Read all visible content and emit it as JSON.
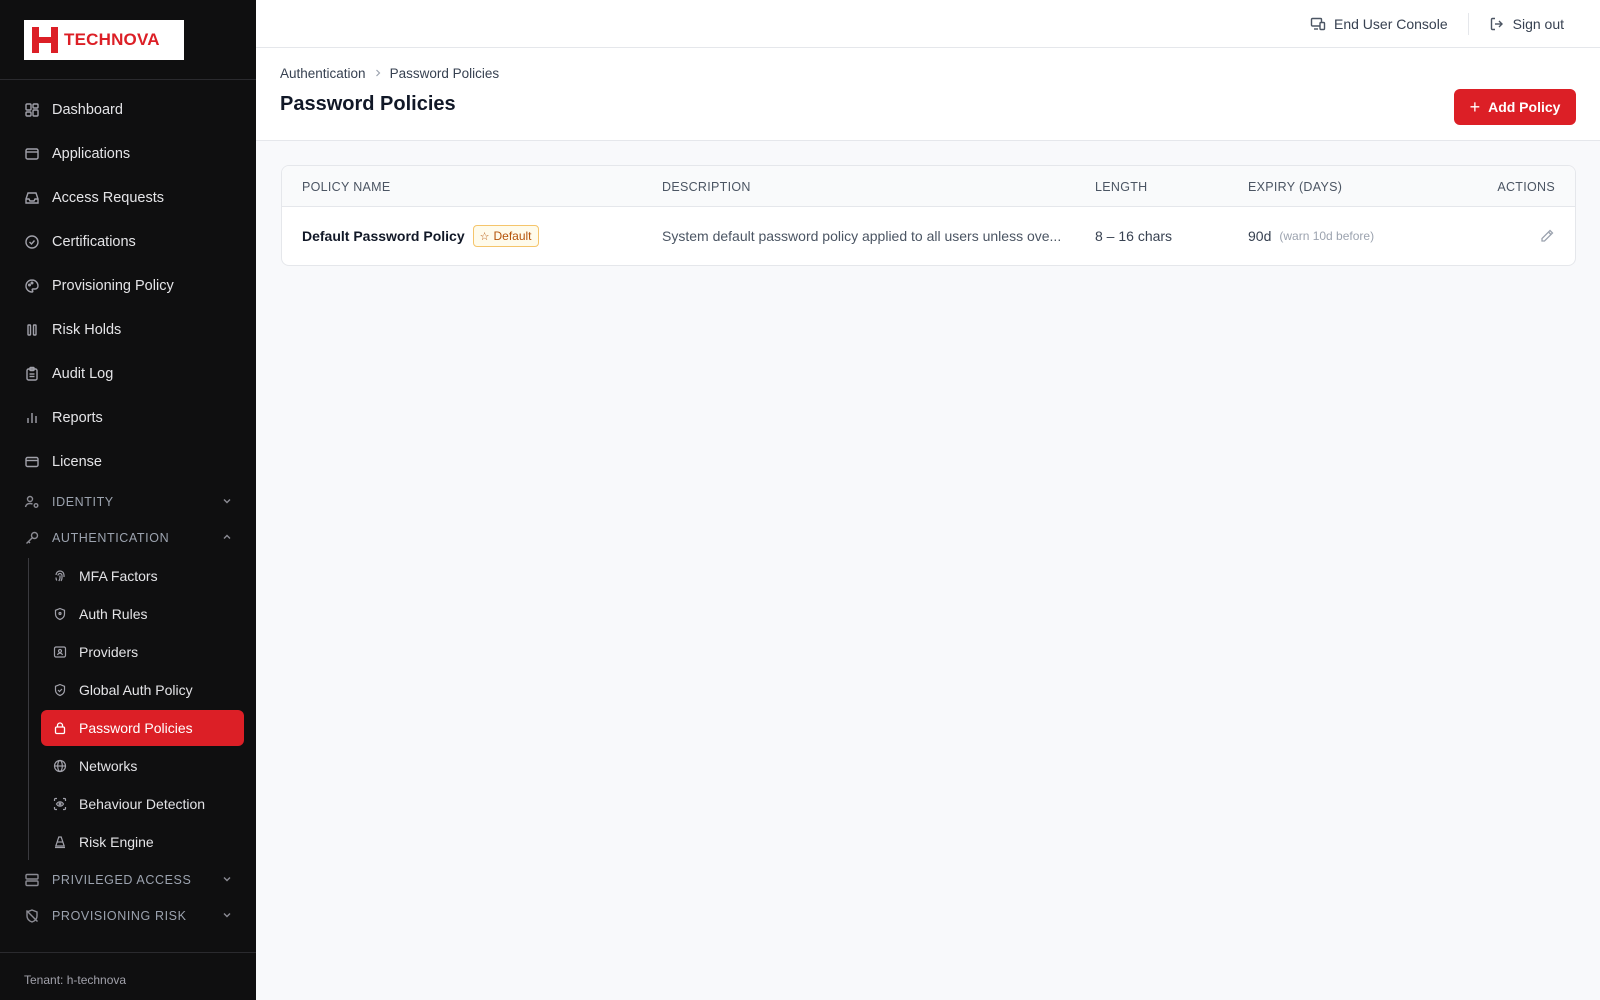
{
  "brand": {
    "name": "TECHNOVA",
    "accent": "#dc1f26"
  },
  "sidebar": {
    "items": [
      {
        "label": "Dashboard",
        "icon": "grid-icon"
      },
      {
        "label": "Applications",
        "icon": "browser-window-icon"
      },
      {
        "label": "Access Requests",
        "icon": "inbox-icon"
      },
      {
        "label": "Certifications",
        "icon": "check-circle-icon"
      },
      {
        "label": "Provisioning Policy",
        "icon": "palette-icon"
      },
      {
        "label": "Risk Holds",
        "icon": "pause-icon"
      },
      {
        "label": "Audit Log",
        "icon": "clipboard-icon"
      },
      {
        "label": "Reports",
        "icon": "bar-chart-icon"
      },
      {
        "label": "License",
        "icon": "credit-card-icon"
      }
    ],
    "sections": {
      "identity": {
        "label": "IDENTITY",
        "icon": "user-cog-icon"
      },
      "authentication": {
        "label": "AUTHENTICATION",
        "icon": "key-icon"
      },
      "privileged": {
        "label": "PRIVILEGED ACCESS",
        "icon": "server-icon"
      },
      "provisioning_risk": {
        "label": "PROVISIONING RISK",
        "icon": "shield-off-icon"
      }
    },
    "auth_items": [
      {
        "label": "MFA Factors",
        "icon": "fingerprint-icon"
      },
      {
        "label": "Auth Rules",
        "icon": "shield-icon"
      },
      {
        "label": "Providers",
        "icon": "id-card-icon"
      },
      {
        "label": "Global Auth Policy",
        "icon": "shield-check-icon"
      },
      {
        "label": "Password Policies",
        "icon": "lock-icon",
        "active": true
      },
      {
        "label": "Networks",
        "icon": "globe-icon"
      },
      {
        "label": "Behaviour Detection",
        "icon": "scan-eye-icon"
      },
      {
        "label": "Risk Engine",
        "icon": "cone-icon"
      }
    ],
    "tenant": "Tenant: h-technova"
  },
  "topbar": {
    "end_user_console": "End User Console",
    "sign_out": "Sign out"
  },
  "header": {
    "breadcrumb": [
      "Authentication",
      "Password Policies"
    ],
    "title": "Password Policies",
    "add_button": "Add Policy"
  },
  "table": {
    "columns": [
      "POLICY NAME",
      "DESCRIPTION",
      "LENGTH",
      "EXPIRY (DAYS)",
      "ACTIONS"
    ],
    "rows": [
      {
        "name": "Default Password Policy",
        "badge": "Default",
        "description": "System default password policy applied to all users unless ove...",
        "length": "8 – 16 chars",
        "expiry": "90d",
        "expiry_note": "(warn 10d before)"
      }
    ]
  }
}
